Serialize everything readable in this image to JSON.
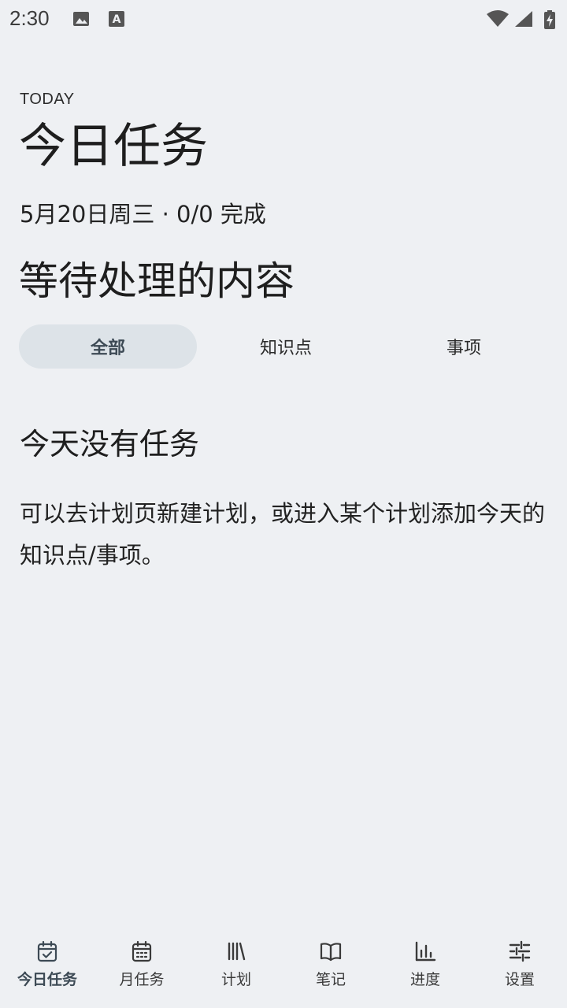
{
  "status_bar": {
    "time": "2:30",
    "icons": [
      "image-icon",
      "text-a-icon",
      "wifi-icon",
      "signal-icon",
      "battery-charging-icon"
    ]
  },
  "header": {
    "overline": "TODAY",
    "title": "今日任务",
    "date_summary": "5月20日周三 · 0/0 完成"
  },
  "section": {
    "title": "等待处理的内容"
  },
  "filter_tabs": [
    {
      "label": "全部",
      "active": true
    },
    {
      "label": "知识点",
      "active": false
    },
    {
      "label": "事项",
      "active": false
    }
  ],
  "empty_state": {
    "title": "今天没有任务",
    "description": "可以去计划页新建计划，或进入某个计划添加今天的知识点/事项。"
  },
  "bottom_nav": [
    {
      "label": "今日任务",
      "icon": "calendar-check-icon",
      "active": true
    },
    {
      "label": "月任务",
      "icon": "calendar-month-icon",
      "active": false
    },
    {
      "label": "计划",
      "icon": "library-icon",
      "active": false
    },
    {
      "label": "笔记",
      "icon": "book-open-icon",
      "active": false
    },
    {
      "label": "进度",
      "icon": "bar-chart-icon",
      "active": false
    },
    {
      "label": "设置",
      "icon": "tune-icon",
      "active": false
    }
  ],
  "colors": {
    "background": "#eef0f3",
    "active_tab_bg": "#dde3e8",
    "active_accent": "#3d4a55"
  }
}
